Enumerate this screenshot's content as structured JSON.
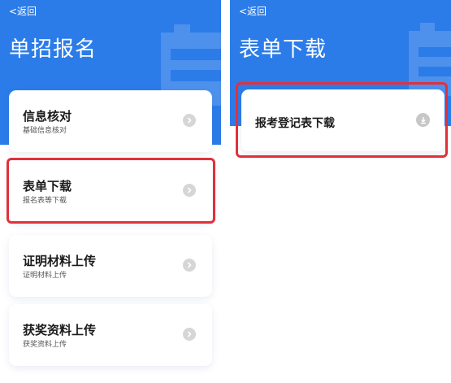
{
  "left_screen": {
    "back_label": "<返回",
    "title": "单招报名",
    "cards": [
      {
        "title": "信息核对",
        "subtitle": "基础信息核对"
      },
      {
        "title": "表单下载",
        "subtitle": "报名表等下载"
      },
      {
        "title": "证明材料上传",
        "subtitle": "证明材料上传"
      },
      {
        "title": "获奖资料上传",
        "subtitle": "获奖资料上传"
      }
    ]
  },
  "right_screen": {
    "back_label": "<返回",
    "title": "表单下载",
    "items": [
      {
        "title": "报考登记表下载"
      }
    ]
  },
  "colors": {
    "header_blue": "#2b7ce9",
    "highlight_red": "#e0313b",
    "icon_grey": "#d6d6d6"
  },
  "icons": {
    "card_arrow": "chevron-right-icon",
    "download": "download-icon",
    "header_decoration": "clipboard-icon"
  }
}
